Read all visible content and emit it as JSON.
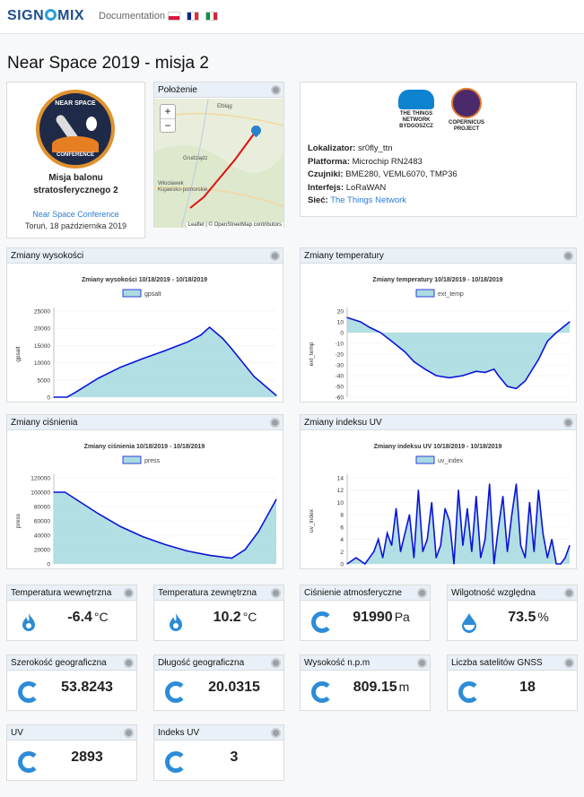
{
  "nav": {
    "brand": "SIGNOMIX",
    "documentation": "Documentation"
  },
  "page_title": "Near Space 2019 - misja 2",
  "mission": {
    "badge_top": "NEAR SPACE",
    "badge_bottom": "CONFERENCE",
    "name_line1": "Misja balonu",
    "name_line2": "stratosferycznego 2",
    "link": "Near Space Conference",
    "date": "Toruń, 18 października 2019"
  },
  "map": {
    "title": "Położenie",
    "zoom_in": "+",
    "zoom_out": "−",
    "attribution": "Leaflet | © OpenStreetMap contributors",
    "places": [
      "Elbląg",
      "Grudziądz",
      "Włocławek",
      "Kujawsko-pomorskie"
    ]
  },
  "info": {
    "ttn_logo": "THE THINGS NETWORK BYDGOSZCZ",
    "copernicus_logo": "COPERNICUS PROJECT",
    "lines": [
      {
        "key": "Lokalizator:",
        "value": "sr0fly_ttn"
      },
      {
        "key": "Platforma:",
        "value": "Microchip RN2483"
      },
      {
        "key": "Czujniki:",
        "value": "BME280, VEML6070, TMP36"
      },
      {
        "key": "Interfejs:",
        "value": "LoRaWAN"
      },
      {
        "key": "Sieć:",
        "value": "The Things Network"
      }
    ]
  },
  "chart_data": [
    {
      "type": "area",
      "header": "Zmiany wysokości",
      "title": "Zmiany wysokości 10/18/2019 - 10/18/2019",
      "legend": "gpsalt",
      "ylabel": "gpsalt",
      "ylim": [
        0,
        25000
      ],
      "yticks": [
        0,
        5000,
        10000,
        15000,
        20000,
        25000
      ],
      "x": [
        0,
        3,
        6,
        10,
        20,
        30,
        40,
        50,
        60,
        66,
        70,
        76,
        80,
        90,
        100
      ],
      "values": [
        0,
        0,
        0,
        1500,
        5500,
        8700,
        11200,
        13500,
        16000,
        18000,
        20300,
        17000,
        14000,
        6000,
        500
      ]
    },
    {
      "type": "area",
      "header": "Zmiany temperatury",
      "title": "Zmiany temperatury 10/18/2019 - 10/18/2019",
      "legend": "ext_temp",
      "ylabel": "ext_temp",
      "ylim": [
        -60,
        20
      ],
      "yticks": [
        -60,
        -50,
        -40,
        -30,
        -20,
        -10,
        0,
        10,
        20
      ],
      "x": [
        0,
        3,
        6,
        10,
        15,
        20,
        26,
        30,
        35,
        40,
        46,
        52,
        58,
        62,
        66,
        68,
        72,
        76,
        80,
        86,
        90,
        94,
        97,
        100
      ],
      "values": [
        14,
        12,
        10,
        5,
        0,
        -8,
        -18,
        -27,
        -34,
        -40,
        -42,
        -40,
        -36,
        -37,
        -34,
        -40,
        -50,
        -52,
        -45,
        -25,
        -8,
        0,
        5,
        10
      ]
    },
    {
      "type": "area",
      "header": "Zmiany ciśnienia",
      "title": "Zmiany ciśnienia 10/18/2019 - 10/18/2019",
      "legend": "press",
      "ylabel": "press",
      "ylim": [
        0,
        120000
      ],
      "yticks": [
        0,
        20000,
        40000,
        60000,
        80000,
        100000,
        120000
      ],
      "x": [
        0,
        5,
        10,
        20,
        30,
        40,
        50,
        60,
        70,
        80,
        86,
        92,
        100
      ],
      "values": [
        100000,
        100000,
        90000,
        70000,
        52000,
        38000,
        27000,
        18000,
        12000,
        8000,
        20000,
        45000,
        90000
      ]
    },
    {
      "type": "area",
      "header": "Zmiany indeksu UV",
      "title": "Zmiany indeksu UV 10/18/2019 - 10/18/2019",
      "legend": "uv_index",
      "ylabel": "uv_index",
      "ylim": [
        0,
        14
      ],
      "yticks": [
        0,
        2,
        4,
        6,
        8,
        10,
        12,
        14
      ],
      "x": [
        0,
        4,
        8,
        12,
        14,
        16,
        18,
        20,
        22,
        24,
        26,
        28,
        30,
        32,
        34,
        36,
        38,
        40,
        42,
        44,
        46,
        48,
        50,
        52,
        54,
        56,
        58,
        60,
        62,
        64,
        66,
        68,
        70,
        72,
        74,
        76,
        78,
        80,
        82,
        84,
        86,
        88,
        90,
        92,
        94,
        96,
        98,
        100
      ],
      "values": [
        0,
        1,
        0,
        2,
        4,
        1,
        5,
        3,
        9,
        2,
        5,
        8,
        1,
        12,
        2,
        4,
        10,
        1,
        3,
        9,
        7,
        0,
        12,
        3,
        9,
        2,
        11,
        1,
        4,
        13,
        0,
        6,
        11,
        2,
        8,
        13,
        3,
        1,
        10,
        2,
        12,
        5,
        1,
        4,
        0,
        0,
        1,
        3
      ]
    }
  ],
  "tiles": [
    {
      "label": "Temperatura wewnętrzna",
      "value": "-6.4",
      "unit": "°C",
      "icon": "flame-icon"
    },
    {
      "label": "Temperatura zewnętrzna",
      "value": "10.2",
      "unit": "°C",
      "icon": "flame-icon"
    },
    {
      "label": "Ciśnienie atmosferyczne",
      "value": "91990",
      "unit": "Pa",
      "icon": "ring-icon"
    },
    {
      "label": "Wilgotność względna",
      "value": "73.5",
      "unit": "%",
      "icon": "drop-icon"
    },
    {
      "label": "Szerokość geograficzna",
      "value": "53.8243",
      "unit": "",
      "icon": "ring-icon"
    },
    {
      "label": "Długość geograficzna",
      "value": "20.0315",
      "unit": "",
      "icon": "ring-icon"
    },
    {
      "label": "Wysokość n.p.m",
      "value": "809.15",
      "unit": "m",
      "icon": "ring-icon"
    },
    {
      "label": "Liczba satelitów GNSS",
      "value": "18",
      "unit": "",
      "icon": "ring-icon"
    },
    {
      "label": "UV",
      "value": "2893",
      "unit": "",
      "icon": "ring-icon"
    },
    {
      "label": "Indeks UV",
      "value": "3",
      "unit": "",
      "icon": "ring-icon"
    }
  ],
  "colors": {
    "accent": "#2d8cd8",
    "line": "#0a14d8",
    "fill": "#a8dce0",
    "brand": "#1f4f8b"
  }
}
